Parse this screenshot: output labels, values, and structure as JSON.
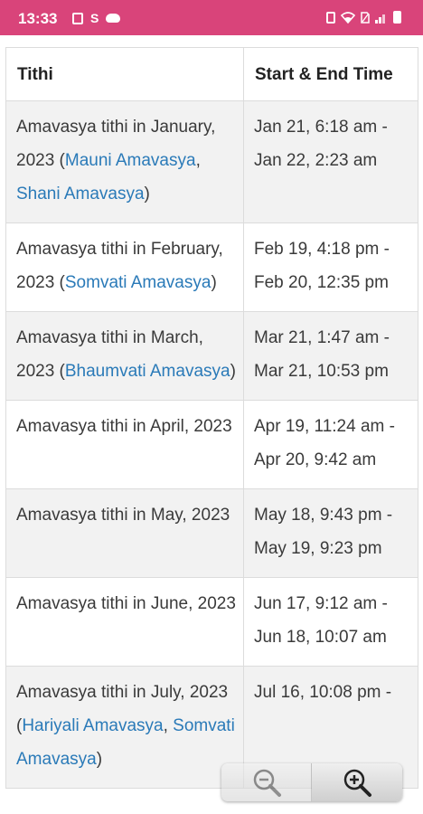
{
  "status_bar": {
    "time": "13:33",
    "left_icons": [
      "sim-card-icon",
      "s-letter-icon",
      "cloud-icon"
    ],
    "right_icons": [
      "vibrate-icon",
      "wifi-icon",
      "no-sim-icon",
      "signal-icon",
      "battery-icon"
    ],
    "s_letter": "S",
    "background": "#d9447a"
  },
  "table": {
    "headers": {
      "tithi": "Tithi",
      "time": "Start & End Time"
    },
    "rows": [
      {
        "tithi_prefix": "Amavasya tithi in January, 2023 (",
        "link1": "Mauni Amavasya",
        "sep": ", ",
        "link2": "Shani Amavasya",
        "tithi_suffix": ")",
        "time": "Jan 21, 6:18 am - Jan 22, 2:23 am"
      },
      {
        "tithi_prefix": "Amavasya tithi in February, 2023 (",
        "link1": "Somvati Amavasya",
        "sep": "",
        "link2": "",
        "tithi_suffix": ")",
        "time": "Feb 19, 4:18 pm - Feb 20, 12:35 pm"
      },
      {
        "tithi_prefix": "Amavasya tithi in March, 2023 (",
        "link1": "Bhaumvati Amavasya",
        "sep": "",
        "link2": "",
        "tithi_suffix": ")",
        "time": "Mar 21, 1:47 am - Mar 21, 10:53 pm"
      },
      {
        "tithi_prefix": "Amavasya tithi in April, 2023",
        "link1": "",
        "sep": "",
        "link2": "",
        "tithi_suffix": "",
        "time": "Apr 19, 11:24 am - Apr 20, 9:42 am"
      },
      {
        "tithi_prefix": "Amavasya tithi in May, 2023",
        "link1": "",
        "sep": "",
        "link2": "",
        "tithi_suffix": "",
        "time": "May 18, 9:43 pm - May 19, 9:23 pm"
      },
      {
        "tithi_prefix": "Amavasya tithi in June, 2023",
        "link1": "",
        "sep": "",
        "link2": "",
        "tithi_suffix": "",
        "time": "Jun 17, 9:12 am - Jun 18, 10:07 am"
      },
      {
        "tithi_prefix": "Amavasya tithi in July, 2023 (",
        "link1": "Hariyali Amavasya",
        "sep": ", ",
        "link2": "Somvati Amavasya",
        "tithi_suffix": ")",
        "time": "Jul 16, 10:08 pm -"
      }
    ],
    "link_color": "#2a7ab8"
  },
  "zoom": {
    "out_icon": "zoom-out-icon",
    "in_icon": "zoom-in-icon"
  }
}
